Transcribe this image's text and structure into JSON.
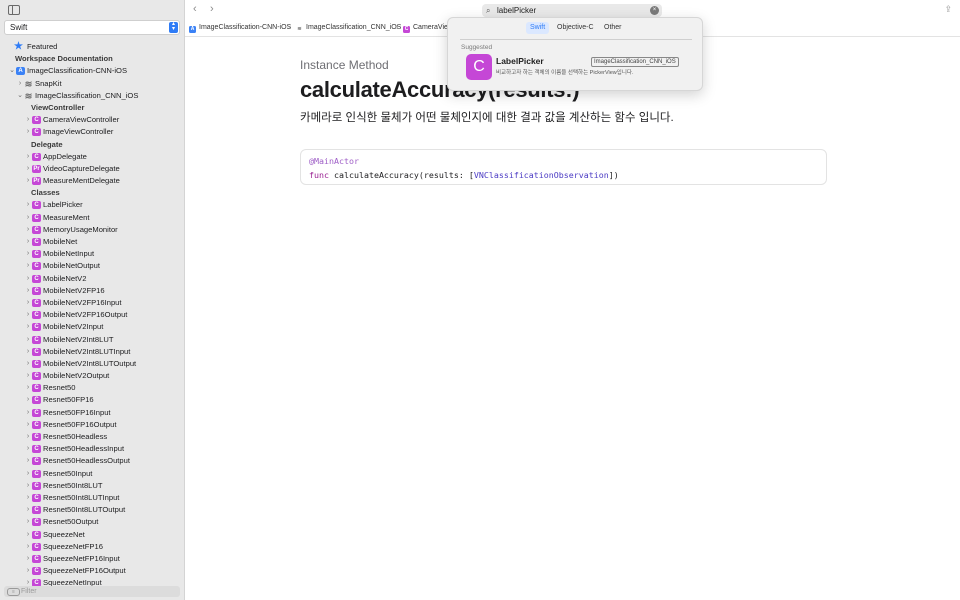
{
  "sidebar": {
    "language": "Swift",
    "filter_placeholder": "Filter",
    "items": [
      {
        "label": "Featured",
        "icon": "star",
        "kind": "link",
        "indent": 0
      },
      {
        "label": "Workspace Documentation",
        "kind": "heading",
        "indent": 0
      },
      {
        "label": "ImageClassification-CNN-iOS",
        "icon": "project",
        "kind": "node",
        "expanded": true,
        "indent": 0
      },
      {
        "label": "SnapKit",
        "icon": "stack",
        "kind": "node",
        "expanded": false,
        "indent": 1
      },
      {
        "label": "ImageClassification_CNN_iOS",
        "icon": "stack",
        "kind": "node",
        "expanded": true,
        "indent": 1
      },
      {
        "label": "ViewController",
        "kind": "section",
        "indent": 2
      },
      {
        "label": "CameraViewController",
        "icon": "C",
        "kind": "node",
        "expanded": false,
        "indent": 2
      },
      {
        "label": "ImageViewController",
        "icon": "C",
        "kind": "node",
        "expanded": false,
        "indent": 2
      },
      {
        "label": "Delegate",
        "kind": "section",
        "indent": 2
      },
      {
        "label": "AppDelegate",
        "icon": "C",
        "kind": "node",
        "expanded": false,
        "indent": 2
      },
      {
        "label": "VideoCaptureDelegate",
        "icon": "Pr",
        "kind": "node",
        "expanded": false,
        "indent": 2
      },
      {
        "label": "MeasureMentDelegate",
        "icon": "Pr",
        "kind": "node",
        "expanded": false,
        "indent": 2
      },
      {
        "label": "Classes",
        "kind": "section",
        "indent": 2
      },
      {
        "label": "LabelPicker",
        "icon": "C",
        "kind": "node",
        "expanded": false,
        "indent": 2
      },
      {
        "label": "MeasureMent",
        "icon": "C",
        "kind": "node",
        "expanded": false,
        "indent": 2
      },
      {
        "label": "MemoryUsageMonitor",
        "icon": "C",
        "kind": "node",
        "expanded": false,
        "indent": 2
      },
      {
        "label": "MobileNet",
        "icon": "C",
        "kind": "node",
        "expanded": false,
        "indent": 2
      },
      {
        "label": "MobileNetInput",
        "icon": "C",
        "kind": "node",
        "expanded": false,
        "indent": 2
      },
      {
        "label": "MobileNetOutput",
        "icon": "C",
        "kind": "node",
        "expanded": false,
        "indent": 2
      },
      {
        "label": "MobileNetV2",
        "icon": "C",
        "kind": "node",
        "expanded": false,
        "indent": 2
      },
      {
        "label": "MobileNetV2FP16",
        "icon": "C",
        "kind": "node",
        "expanded": false,
        "indent": 2
      },
      {
        "label": "MobileNetV2FP16Input",
        "icon": "C",
        "kind": "node",
        "expanded": false,
        "indent": 2
      },
      {
        "label": "MobileNetV2FP16Output",
        "icon": "C",
        "kind": "node",
        "expanded": false,
        "indent": 2
      },
      {
        "label": "MobileNetV2Input",
        "icon": "C",
        "kind": "node",
        "expanded": false,
        "indent": 2
      },
      {
        "label": "MobileNetV2Int8LUT",
        "icon": "C",
        "kind": "node",
        "expanded": false,
        "indent": 2
      },
      {
        "label": "MobileNetV2Int8LUTInput",
        "icon": "C",
        "kind": "node",
        "expanded": false,
        "indent": 2
      },
      {
        "label": "MobileNetV2Int8LUTOutput",
        "icon": "C",
        "kind": "node",
        "expanded": false,
        "indent": 2
      },
      {
        "label": "MobileNetV2Output",
        "icon": "C",
        "kind": "node",
        "expanded": false,
        "indent": 2
      },
      {
        "label": "Resnet50",
        "icon": "C",
        "kind": "node",
        "expanded": false,
        "indent": 2
      },
      {
        "label": "Resnet50FP16",
        "icon": "C",
        "kind": "node",
        "expanded": false,
        "indent": 2
      },
      {
        "label": "Resnet50FP16Input",
        "icon": "C",
        "kind": "node",
        "expanded": false,
        "indent": 2
      },
      {
        "label": "Resnet50FP16Output",
        "icon": "C",
        "kind": "node",
        "expanded": false,
        "indent": 2
      },
      {
        "label": "Resnet50Headless",
        "icon": "C",
        "kind": "node",
        "expanded": false,
        "indent": 2
      },
      {
        "label": "Resnet50HeadlessInput",
        "icon": "C",
        "kind": "node",
        "expanded": false,
        "indent": 2
      },
      {
        "label": "Resnet50HeadlessOutput",
        "icon": "C",
        "kind": "node",
        "expanded": false,
        "indent": 2
      },
      {
        "label": "Resnet50Input",
        "icon": "C",
        "kind": "node",
        "expanded": false,
        "indent": 2
      },
      {
        "label": "Resnet50Int8LUT",
        "icon": "C",
        "kind": "node",
        "expanded": false,
        "indent": 2
      },
      {
        "label": "Resnet50Int8LUTInput",
        "icon": "C",
        "kind": "node",
        "expanded": false,
        "indent": 2
      },
      {
        "label": "Resnet50Int8LUTOutput",
        "icon": "C",
        "kind": "node",
        "expanded": false,
        "indent": 2
      },
      {
        "label": "Resnet50Output",
        "icon": "C",
        "kind": "node",
        "expanded": false,
        "indent": 2
      },
      {
        "label": "SqueezeNet",
        "icon": "C",
        "kind": "node",
        "expanded": false,
        "indent": 2
      },
      {
        "label": "SqueezeNetFP16",
        "icon": "C",
        "kind": "node",
        "expanded": false,
        "indent": 2
      },
      {
        "label": "SqueezeNetFP16Input",
        "icon": "C",
        "kind": "node",
        "expanded": false,
        "indent": 2
      },
      {
        "label": "SqueezeNetFP16Output",
        "icon": "C",
        "kind": "node",
        "expanded": false,
        "indent": 2
      },
      {
        "label": "SqueezeNetInput",
        "icon": "C",
        "kind": "node",
        "expanded": false,
        "indent": 2
      }
    ]
  },
  "search": {
    "value": "labelPicker"
  },
  "breadcrumbs": [
    {
      "label": "ImageClassification-CNN-iOS",
      "icon": "project"
    },
    {
      "label": "ImageClassification_CNN_iOS",
      "icon": "stack"
    },
    {
      "label": "CameraView",
      "icon": "C"
    }
  ],
  "popover": {
    "tabs": [
      {
        "label": "Swift",
        "active": true
      },
      {
        "label": "Objective-C",
        "active": false
      },
      {
        "label": "Other",
        "active": false
      }
    ],
    "heading": "Suggested",
    "result": {
      "icon_letter": "C",
      "name": "LabelPicker",
      "module": "ImageClassification_CNN_iOS",
      "description": "비교하고자 하는 객체의 이름을 선택하는 PickerView입니다."
    }
  },
  "doc": {
    "eyebrow": "Instance Method",
    "title": "calculateAccuracy(results:)",
    "abstract": "카메라로 인식한 물체가 어떤 물체인지에 대한 결과 값을 계산하는 함수 입니다.",
    "declaration": {
      "attribute": "@MainActor",
      "keyword": "func",
      "signature": "calculateAccuracy(results: [",
      "type": "VNClassificationObservation",
      "closing": "])"
    }
  },
  "colors": {
    "accent": "#2f7cf6",
    "class_icon": "#c547d6",
    "project_icon": "#3b82f6"
  }
}
